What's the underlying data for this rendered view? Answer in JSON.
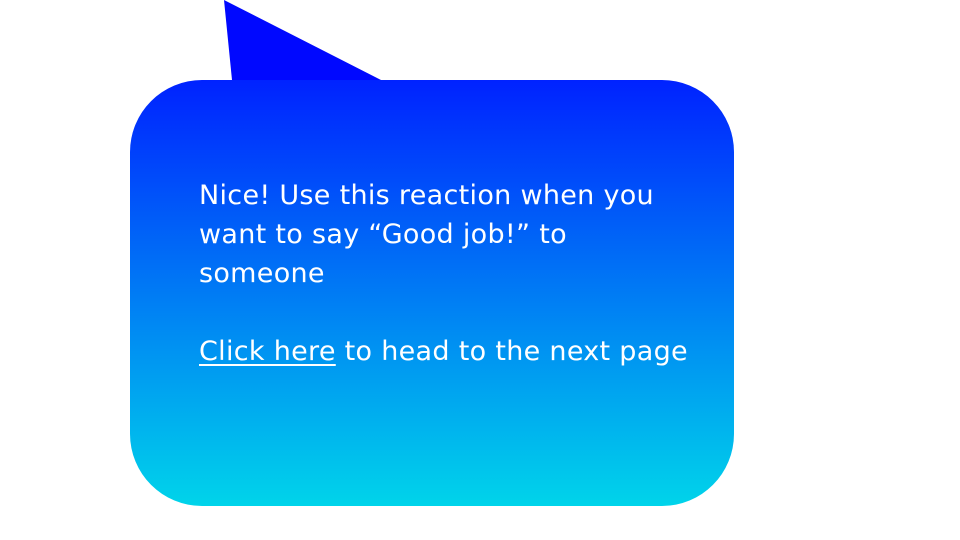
{
  "bubble": {
    "message": "Nice! Use this reaction when you want to say “Good job!” to someone",
    "link_label": "Click here",
    "link_suffix": " to head to the next page",
    "gradient_top": "#0022ff",
    "gradient_bottom": "#00d4ea",
    "tail_color": "#0008ff",
    "text_color": "#ffffff"
  }
}
